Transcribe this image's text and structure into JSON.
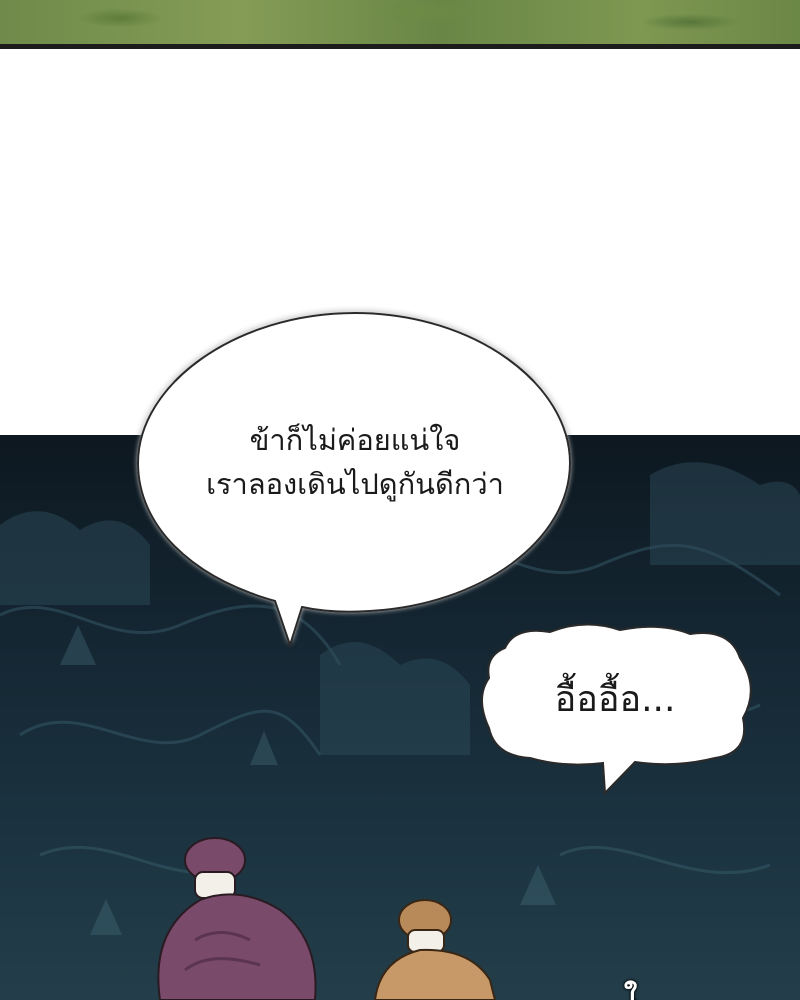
{
  "speech_bubble": {
    "line1": "ข้าก็ไม่ค่อยแน่ใจ",
    "line2": "เราลองเดินไปดูกันดีกว่า"
  },
  "thought_bubble": {
    "text": "อื้ออื้อ..."
  },
  "colors": {
    "foliage": "#6f8a4a",
    "forest_dark": "#142632",
    "bubble_fill": "#ffffff",
    "text": "#1a1a1a",
    "hair_purple": "#7a4a6a",
    "hair_tan": "#b88a5a"
  }
}
